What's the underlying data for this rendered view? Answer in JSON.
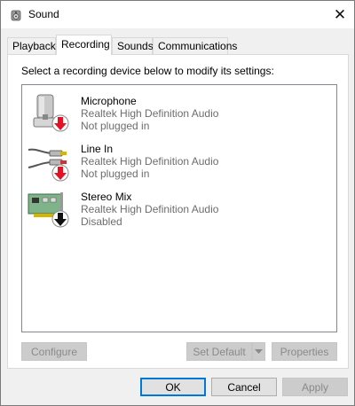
{
  "window": {
    "title": "Sound",
    "icon": "speaker-icon",
    "close_glyph": "✕"
  },
  "tabs": [
    {
      "label": "Playback",
      "active": false
    },
    {
      "label": "Recording",
      "active": true
    },
    {
      "label": "Sounds",
      "active": false
    },
    {
      "label": "Communications",
      "active": false
    }
  ],
  "panel": {
    "instructions": "Select a recording device below to modify its settings:",
    "devices": [
      {
        "name": "Microphone",
        "driver": "Realtek High Definition Audio",
        "status": "Not plugged in",
        "icon": "microphone-icon",
        "badge": "red-down-arrow-icon"
      },
      {
        "name": "Line In",
        "driver": "Realtek High Definition Audio",
        "status": "Not plugged in",
        "icon": "line-in-cable-icon",
        "badge": "red-down-arrow-icon"
      },
      {
        "name": "Stereo Mix",
        "driver": "Realtek High Definition Audio",
        "status": "Disabled",
        "icon": "sound-card-icon",
        "badge": "black-down-arrow-icon"
      }
    ],
    "buttons": {
      "configure": "Configure",
      "set_default": "Set Default",
      "properties": "Properties"
    }
  },
  "footer": {
    "ok": "OK",
    "cancel": "Cancel",
    "apply": "Apply"
  },
  "colors": {
    "red_badge": "#e81123",
    "accent": "#0078d7",
    "disabled_text": "#6d6d6d"
  }
}
